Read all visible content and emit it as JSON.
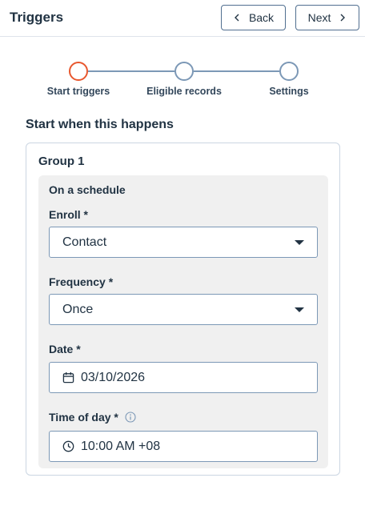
{
  "header": {
    "title": "Triggers",
    "back_label": "Back",
    "next_label": "Next"
  },
  "stepper": {
    "steps": [
      {
        "label": "Start triggers",
        "state": "active"
      },
      {
        "label": "Eligible records",
        "state": "inactive"
      },
      {
        "label": "Settings",
        "state": "inactive"
      }
    ]
  },
  "main": {
    "section_title": "Start when this happens",
    "group": {
      "title": "Group 1",
      "panel_title": "On a schedule",
      "fields": {
        "enroll": {
          "label": "Enroll *",
          "value": "Contact"
        },
        "frequency": {
          "label": "Frequency *",
          "value": "Once"
        },
        "date": {
          "label": "Date *",
          "value": "03/10/2026"
        },
        "time": {
          "label": "Time of day *",
          "value": "10:00 AM +08"
        }
      }
    }
  },
  "colors": {
    "active_step": "#e8572e",
    "inactive_step": "#7c98b6",
    "panel_bg": "#f0f0f0",
    "text": "#213343"
  },
  "icons": [
    "chevron-left-icon",
    "chevron-right-icon",
    "caret-down-icon",
    "calendar-icon",
    "clock-icon",
    "info-icon"
  ]
}
